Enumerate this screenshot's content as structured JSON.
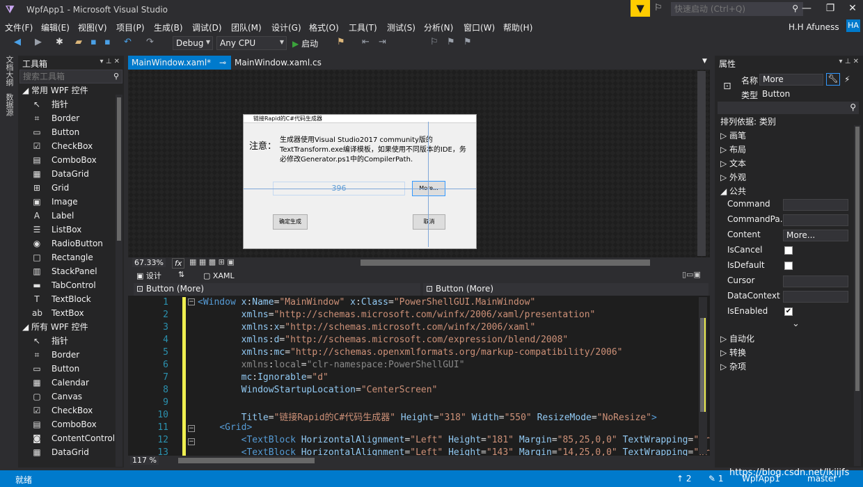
{
  "window": {
    "title": "WpfApp1 - Microsoft Visual Studio",
    "quick_launch_placeholder": "快速启动 (Ctrl+Q)",
    "user": "H.H Afuness",
    "avatar": "HA"
  },
  "menu": [
    "文件(F)",
    "编辑(E)",
    "视图(V)",
    "项目(P)",
    "生成(B)",
    "调试(D)",
    "团队(M)",
    "设计(G)",
    "格式(O)",
    "工具(T)",
    "测试(S)",
    "分析(N)",
    "窗口(W)",
    "帮助(H)"
  ],
  "toolbar": {
    "config": "Debug",
    "platform": "Any CPU",
    "start": "启动"
  },
  "side_tabs": [
    "文档大纲",
    "数据源"
  ],
  "toolbox": {
    "title": "工具箱",
    "search_placeholder": "搜索工具箱",
    "group1": "常用 WPF 控件",
    "group1_items": [
      {
        "icon": "pointer-icon",
        "glyph": "↖",
        "label": "指针"
      },
      {
        "icon": "border-icon",
        "glyph": "⌗",
        "label": "Border"
      },
      {
        "icon": "button-icon",
        "glyph": "▭",
        "label": "Button"
      },
      {
        "icon": "checkbox-icon",
        "glyph": "☑",
        "label": "CheckBox"
      },
      {
        "icon": "combobox-icon",
        "glyph": "▤",
        "label": "ComboBox"
      },
      {
        "icon": "datagrid-icon",
        "glyph": "▦",
        "label": "DataGrid"
      },
      {
        "icon": "grid-icon",
        "glyph": "⊞",
        "label": "Grid"
      },
      {
        "icon": "image-icon",
        "glyph": "▣",
        "label": "Image"
      },
      {
        "icon": "label-icon",
        "glyph": "A",
        "label": "Label"
      },
      {
        "icon": "listbox-icon",
        "glyph": "☰",
        "label": "ListBox"
      },
      {
        "icon": "radiobutton-icon",
        "glyph": "◉",
        "label": "RadioButton"
      },
      {
        "icon": "rectangle-icon",
        "glyph": "□",
        "label": "Rectangle"
      },
      {
        "icon": "stackpanel-icon",
        "glyph": "▥",
        "label": "StackPanel"
      },
      {
        "icon": "tabcontrol-icon",
        "glyph": "▬",
        "label": "TabControl"
      },
      {
        "icon": "textblock-icon",
        "glyph": "T",
        "label": "TextBlock"
      },
      {
        "icon": "textbox-icon",
        "glyph": "ab",
        "label": "TextBox"
      }
    ],
    "group2": "所有 WPF 控件",
    "group2_items": [
      {
        "icon": "pointer-icon",
        "glyph": "↖",
        "label": "指针"
      },
      {
        "icon": "border-icon",
        "glyph": "⌗",
        "label": "Border"
      },
      {
        "icon": "button-icon",
        "glyph": "▭",
        "label": "Button"
      },
      {
        "icon": "calendar-icon",
        "glyph": "▦",
        "label": "Calendar"
      },
      {
        "icon": "canvas-icon",
        "glyph": "▢",
        "label": "Canvas"
      },
      {
        "icon": "checkbox-icon",
        "glyph": "☑",
        "label": "CheckBox"
      },
      {
        "icon": "combobox-icon",
        "glyph": "▤",
        "label": "ComboBox"
      },
      {
        "icon": "contentcontrol-icon",
        "glyph": "◙",
        "label": "ContentControl"
      },
      {
        "icon": "datagrid-icon",
        "glyph": "▦",
        "label": "DataGrid"
      }
    ]
  },
  "doc_tabs": {
    "active": "MainWindow.xaml*",
    "other": "MainWindow.xaml.cs"
  },
  "designer": {
    "window_title": "链接Rapid的C#代码生成器",
    "note_label": "注意：",
    "note_text": "生成器使用Visual Studio2017 community版的TextTransform.exe编译模板，如果使用不同版本的IDE，务必修改Generator.ps1中的CompilerPath.",
    "guide_width": "396",
    "more_button": "More...",
    "ok_button": "确定生成",
    "cancel_button": "取消",
    "zoom": "67.33%",
    "fx": "fx"
  },
  "split": {
    "design_tab": "设计",
    "xaml_tab": "XAML",
    "nav_left": "Button (More)",
    "nav_right": "Button (More)"
  },
  "editor": {
    "zoom": "117 %",
    "line_numbers": [
      "1",
      "2",
      "3",
      "4",
      "5",
      "6",
      "7",
      "8",
      "9",
      "10",
      "11",
      "12",
      "13"
    ]
  },
  "properties": {
    "title": "属性",
    "name_label": "名称",
    "name_value": "More",
    "type_label": "类型",
    "type_value": "Button",
    "sort": "排列依据: 类别",
    "categories": [
      "画笔",
      "布局",
      "文本",
      "外观"
    ],
    "common": "公共",
    "rows": [
      {
        "label": "Command",
        "value": ""
      },
      {
        "label": "CommandPa...",
        "value": ""
      },
      {
        "label": "Content",
        "value": "More..."
      },
      {
        "label": "IsCancel",
        "check": ""
      },
      {
        "label": "IsDefault",
        "check": ""
      },
      {
        "label": "Cursor",
        "value": ""
      },
      {
        "label": "DataContext",
        "value": ""
      },
      {
        "label": "IsEnabled",
        "check": "✔"
      }
    ],
    "more_categories": [
      "自动化",
      "转换",
      "杂项"
    ]
  },
  "status": {
    "ready": "就绪",
    "up": "↑ 2",
    "edit": "✎ 1",
    "repo": "WpfApp1",
    "branch": "master"
  },
  "watermark": "https://blog.csdn.net/lkjijfs",
  "colors": {
    "accent": "#007acc",
    "filter": "#ffcc00"
  }
}
